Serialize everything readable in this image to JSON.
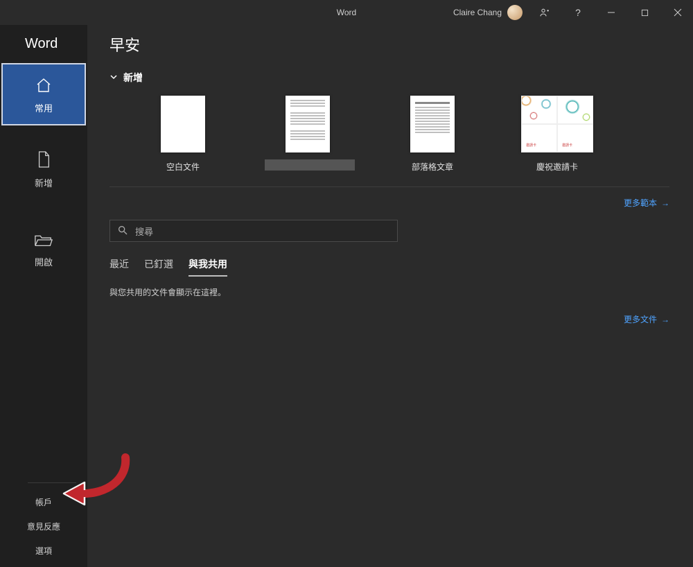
{
  "titlebar": {
    "app_title": "Word",
    "user_name": "Claire Chang"
  },
  "sidebar": {
    "brand": "Word",
    "items": [
      {
        "label": "常用",
        "icon": "home-icon"
      },
      {
        "label": "新增",
        "icon": "new-doc-icon"
      },
      {
        "label": "開啟",
        "icon": "folder-open-icon"
      }
    ],
    "bottom": {
      "account": "帳戶",
      "feedback": "意見反應",
      "options": "選項"
    }
  },
  "main": {
    "greeting": "早安",
    "new_section": "新增",
    "templates": [
      {
        "label": "空白文件"
      },
      {
        "label": ""
      },
      {
        "label": "部落格文章"
      },
      {
        "label": "慶祝邀請卡"
      }
    ],
    "more_templates": "更多範本",
    "search": {
      "placeholder": "搜尋"
    },
    "tabs": [
      {
        "label": "最近"
      },
      {
        "label": "已釘選"
      },
      {
        "label": "與我共用"
      }
    ],
    "empty_shared": "與您共用的文件會顯示在這裡。",
    "more_docs": "更多文件"
  }
}
